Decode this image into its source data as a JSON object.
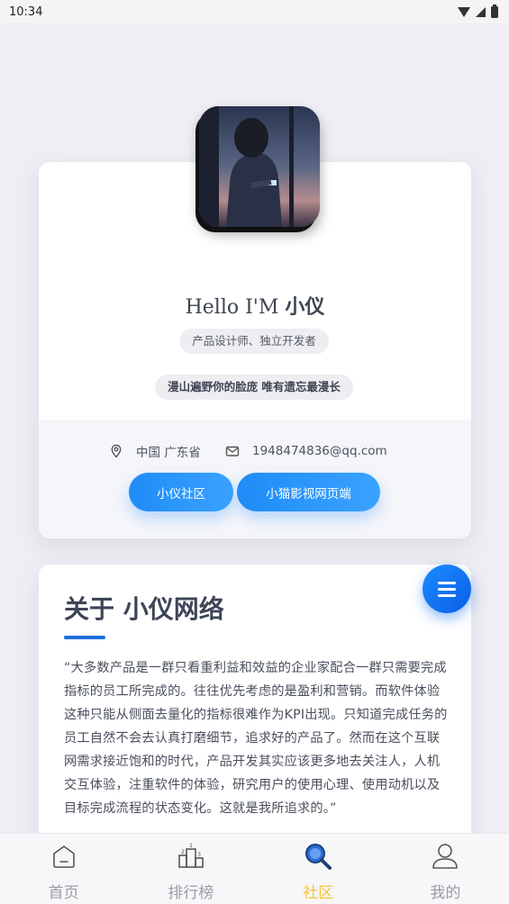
{
  "status_bar": {
    "time": "10:34"
  },
  "profile": {
    "greeting_prefix": "Hello I'M",
    "name": "小仪",
    "role": "产品设计师、独立开发者",
    "motto": "漫山遍野你的脸庞 唯有遗忘最漫长",
    "location": "中国 广东省",
    "email": "1948474836@qq.com",
    "buttons": [
      "小仪社区",
      "小猫影视网页端"
    ]
  },
  "about": {
    "title": "关于 小仪网络",
    "text": "“大多数产品是一群只看重利益和效益的企业家配合一群只需要完成指标的员工所完成的。往往优先考虑的是盈利和营销。而软件体验这种只能从侧面去量化的指标很难作为KPI出现。只知道完成任务的员工自然不会去认真打磨细节，追求好的产品了。然而在这个互联网需求接近饱和的时代，产品开发其实应该更多地去关注人，人机交互体验，注重软件的体验，研究用户的使用心理、使用动机以及目标完成流程的状态变化。这就是我所追求的。”"
  },
  "tabs": [
    {
      "label": "首页",
      "icon": "home-icon",
      "active": false
    },
    {
      "label": "排行榜",
      "icon": "ranking-icon",
      "active": false
    },
    {
      "label": "社区",
      "icon": "search-icon",
      "active": true
    },
    {
      "label": "我的",
      "icon": "user-icon",
      "active": false
    }
  ],
  "colors": {
    "accent": "#1f8cf7",
    "active_tab": "#f5c33b",
    "background": "#eeeef4"
  }
}
